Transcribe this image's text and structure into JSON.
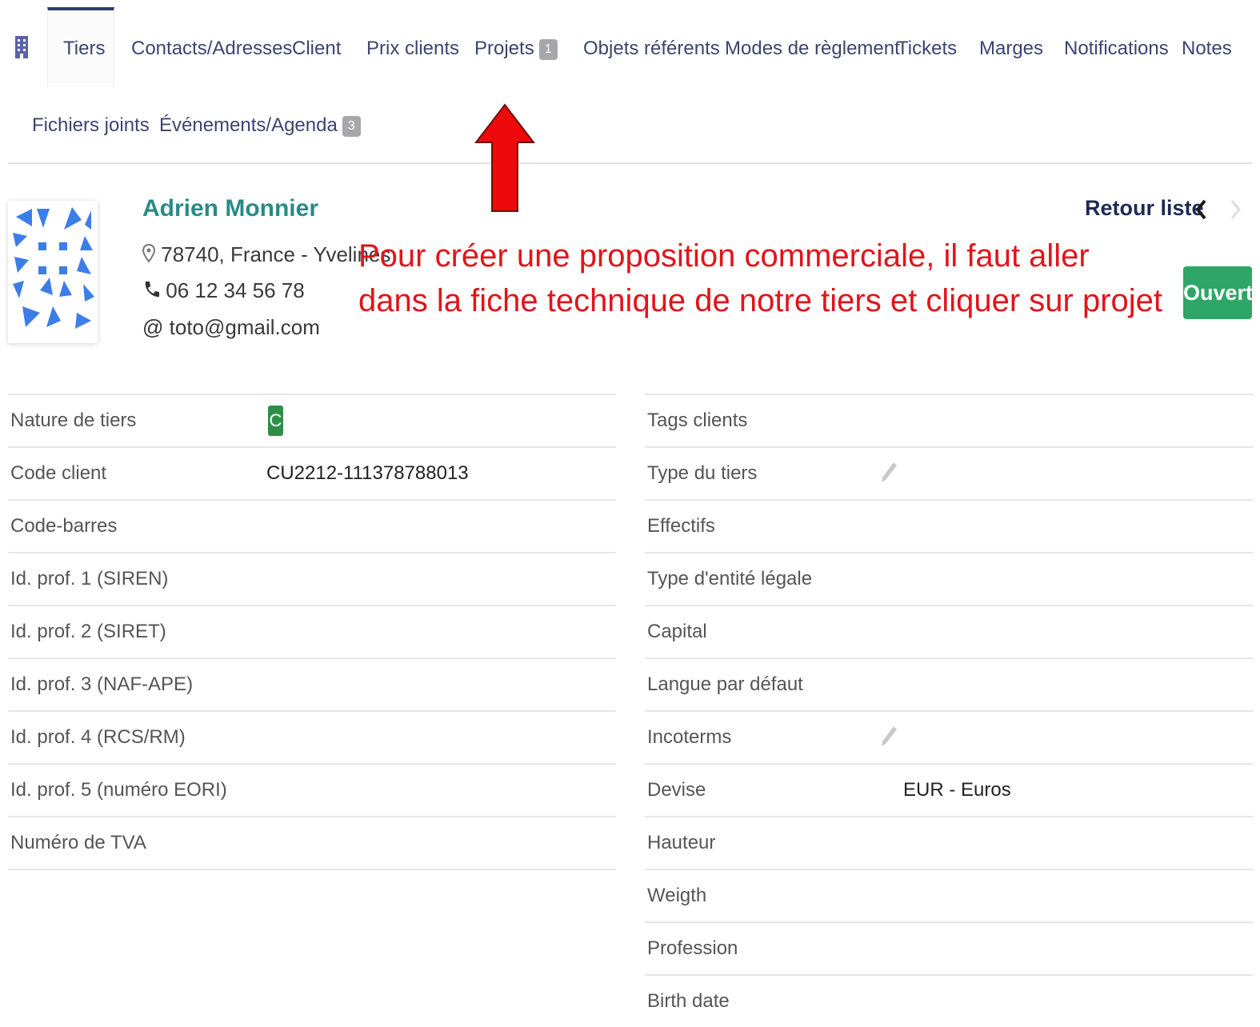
{
  "tabs": [
    {
      "label": "Tiers"
    },
    {
      "label": "Contacts/Adresses"
    },
    {
      "label": "Client"
    },
    {
      "label": "Prix clients"
    },
    {
      "label": "Projets",
      "badge": "1"
    },
    {
      "label": "Objets référents"
    },
    {
      "label": "Modes de règlement"
    },
    {
      "label": "Tickets"
    },
    {
      "label": "Marges"
    },
    {
      "label": "Notifications"
    },
    {
      "label": "Notes"
    },
    {
      "label": "Fichiers joints"
    },
    {
      "label": "Événements/Agenda",
      "badge": "3"
    }
  ],
  "header": {
    "name": "Adrien Monnier",
    "address": "78740, France - Yvelines",
    "phone": "06 12 34 56 78",
    "email": "toto@gmail.com",
    "back_label": "Retour liste",
    "status": "Ouvert"
  },
  "annotation": {
    "text": "Pour créer une proposition commerciale, il faut aller dans la fiche technique de notre tiers et cliquer sur projet"
  },
  "fields_left": [
    {
      "label": "Nature de tiers",
      "badge": "C"
    },
    {
      "label": "Code client",
      "value": "CU2212-111378788013"
    },
    {
      "label": "Code-barres"
    },
    {
      "label": "Id. prof. 1 (SIREN)"
    },
    {
      "label": "Id. prof. 2 (SIRET)"
    },
    {
      "label": "Id. prof. 3 (NAF-APE)"
    },
    {
      "label": "Id. prof. 4 (RCS/RM)"
    },
    {
      "label": "Id. prof. 5 (numéro EORI)"
    },
    {
      "label": "Numéro de TVA"
    }
  ],
  "fields_right": [
    {
      "label": "Tags clients"
    },
    {
      "label": "Type du tiers"
    },
    {
      "label": "Effectifs"
    },
    {
      "label": "Type d'entité légale"
    },
    {
      "label": "Capital"
    },
    {
      "label": "Langue par défaut"
    },
    {
      "label": "Incoterms"
    },
    {
      "label": "Devise",
      "value": "EUR - Euros"
    },
    {
      "label": "Hauteur"
    },
    {
      "label": "Weigth"
    },
    {
      "label": "Profession"
    },
    {
      "label": "Birth date"
    }
  ],
  "colors": {
    "accent": "#2a8a86",
    "status": "#2ea667",
    "annotation": "#e1141b",
    "nav": "#1f2a54"
  },
  "icons": {
    "tab_icon": "building-icon",
    "address_icon": "map-marker-icon",
    "phone_icon": "phone-icon",
    "email_icon": "at-icon",
    "edit_icon": "pencil-icon",
    "prev_icon": "chevron-left-icon",
    "next_icon": "chevron-right-icon"
  }
}
